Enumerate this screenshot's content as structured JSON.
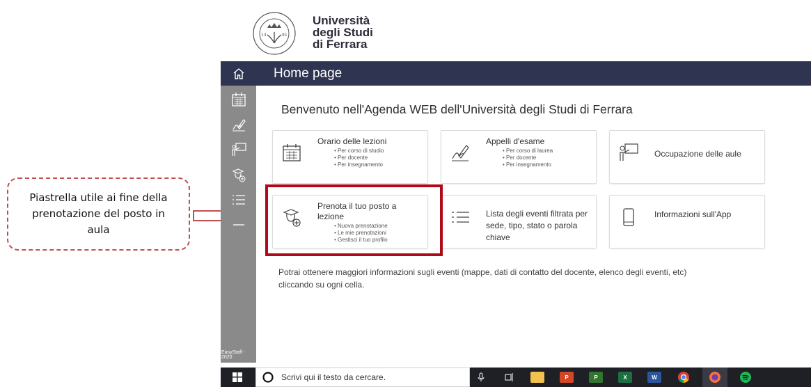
{
  "annotation": {
    "text": "Piastrella utile ai fine della prenotazione del posto in aula",
    "color": "#c0504d"
  },
  "brand": {
    "line1": "Università",
    "line2": "degli Studi",
    "line3": "di Ferrara",
    "seal_icon": "university-seal"
  },
  "header": {
    "home_icon": "home-icon",
    "title": "Home page"
  },
  "sidebar": {
    "items": [
      {
        "icon": "calendar-icon"
      },
      {
        "icon": "signature-icon"
      },
      {
        "icon": "classroom-icon"
      },
      {
        "icon": "booking-icon"
      },
      {
        "icon": "list-icon"
      },
      {
        "icon": "mobile-icon"
      }
    ],
    "footer": "EasyStaff - 2020"
  },
  "main": {
    "welcome": "Benvenuto nell'Agenda WEB dell'Università degli Studi di Ferrara",
    "tiles": [
      {
        "title": "Orario delle lezioni",
        "bullets": [
          "Per corso di studio",
          "Per docente",
          "Per insegnamento"
        ],
        "icon": "calendar-icon"
      },
      {
        "title": "Appelli d'esame",
        "bullets": [
          "Per corso di laurea",
          "Per docente",
          "Per insegnamento"
        ],
        "icon": "signature-icon"
      },
      {
        "title": "Occupazione delle aule",
        "bullets": [],
        "icon": "classroom-icon"
      },
      {
        "title": "Prenota il tuo posto a lezione",
        "bullets": [
          "Nuova prenotazione",
          "Le mie prenotazioni",
          "Gestisci il tuo profilo"
        ],
        "icon": "booking-icon"
      },
      {
        "title": "Lista degli eventi filtrata per sede, tipo, stato o parola chiave",
        "bullets": [],
        "icon": "list-icon"
      },
      {
        "title": "Informazioni sull'App",
        "bullets": [],
        "icon": "mobile-icon"
      }
    ],
    "info": "Potrai ottenere maggiori informazioni sugli eventi (mappe, dati di contatto del docente, elenco degli eventi, etc) cliccando su ogni cella.",
    "highlight_color": "#b00a1a",
    "header_bg": "#2f3450",
    "sidebar_bg": "#8a8a8a"
  },
  "taskbar": {
    "search_placeholder": "Scrivi qui il testo da cercare.",
    "apps": [
      {
        "icon": "microphone-icon"
      },
      {
        "icon": "task-view-icon"
      },
      {
        "icon": "file-explorer-icon"
      },
      {
        "icon": "powerpoint-icon",
        "label": "P"
      },
      {
        "icon": "project-icon",
        "label": "P"
      },
      {
        "icon": "excel-icon",
        "label": "X"
      },
      {
        "icon": "word-icon",
        "label": "W"
      },
      {
        "icon": "chrome-icon"
      },
      {
        "icon": "firefox-icon"
      },
      {
        "icon": "spotify-icon"
      }
    ]
  }
}
